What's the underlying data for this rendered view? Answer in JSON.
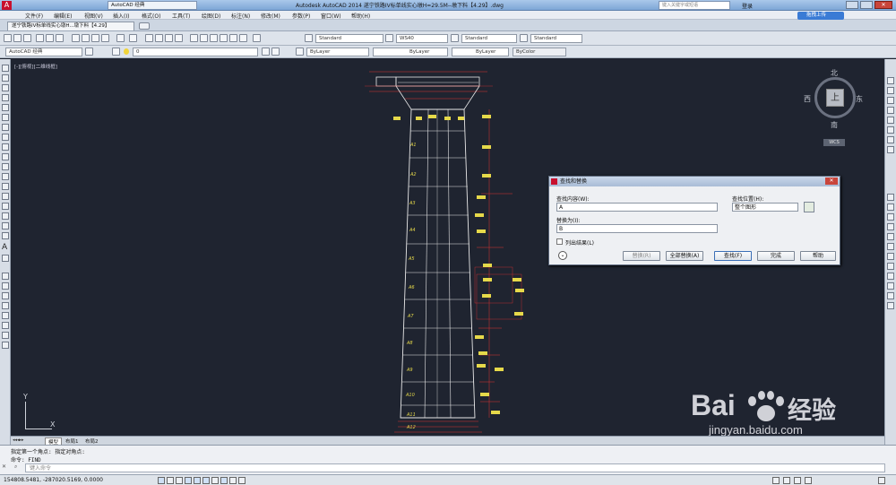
{
  "app": {
    "title": "Autodesk AutoCAD 2014    遂宁铁路IV标单线实心墩H=29.5M--墩下料【4.29】.dwg"
  },
  "quick_access": {
    "workspace": "AutoCAD 经典"
  },
  "search": {
    "placeholder": "键入关键字或短语"
  },
  "login": {
    "label": "登录"
  },
  "cloud_button": {
    "label": "拖拽上传"
  },
  "menu": {
    "items": [
      "文件(F)",
      "编辑(E)",
      "视图(V)",
      "插入(I)",
      "格式(O)",
      "工具(T)",
      "绘图(D)",
      "标注(N)",
      "修改(M)",
      "参数(P)",
      "窗口(W)",
      "帮助(H)"
    ]
  },
  "doc_tab": {
    "label": "遂宁铁路IV标单线实心墩H...墩下料【4.29】"
  },
  "toolbar": {
    "text_style": "Standard",
    "dim_style": "WS40",
    "table_style": "Standard",
    "mleader_style": "Standard",
    "workspace2": "AutoCAD 经典",
    "layer": "0",
    "color": "ByLayer",
    "linetype": "ByLayer",
    "lineweight": "ByLayer",
    "plotstyle": "ByColor"
  },
  "viewport": {
    "label": "[-][俯视][二维线框]"
  },
  "viewcube": {
    "north": "北",
    "south": "南",
    "east": "东",
    "west": "西",
    "top": "上",
    "wcs": "WCS"
  },
  "ucs": {
    "x": "X",
    "y": "Y"
  },
  "drawing": {
    "labels": [
      "A",
      "A1",
      "A2",
      "A3",
      "A4",
      "A5",
      "A6",
      "A7",
      "A8",
      "A9",
      "A10",
      "A11",
      "A12"
    ]
  },
  "layout_tabs": [
    "模型",
    "布局1",
    "布局2"
  ],
  "dialog": {
    "title": "查找和替换",
    "find_label": "查找内容(W):",
    "find_value": "A",
    "replace_label": "替换为(I):",
    "replace_value": "B",
    "where_label": "查找位置(H):",
    "where_value": "整个图形",
    "list_results": "列出结果(L)",
    "btn_replace": "替换(R)",
    "btn_replace_all": "全部替换(A)",
    "btn_find": "查找(F)",
    "btn_done": "完成",
    "btn_help": "帮助"
  },
  "command": {
    "history1": "指定第一个角点: 指定对角点:",
    "history2": "命令: FIND",
    "prompt": "键入命令"
  },
  "status": {
    "coords": "154808.5481, -287020.5169, 0.0000"
  },
  "watermark": {
    "brand": "Bai",
    "brand2": "经验",
    "url": "jingyan.baidu.com"
  }
}
